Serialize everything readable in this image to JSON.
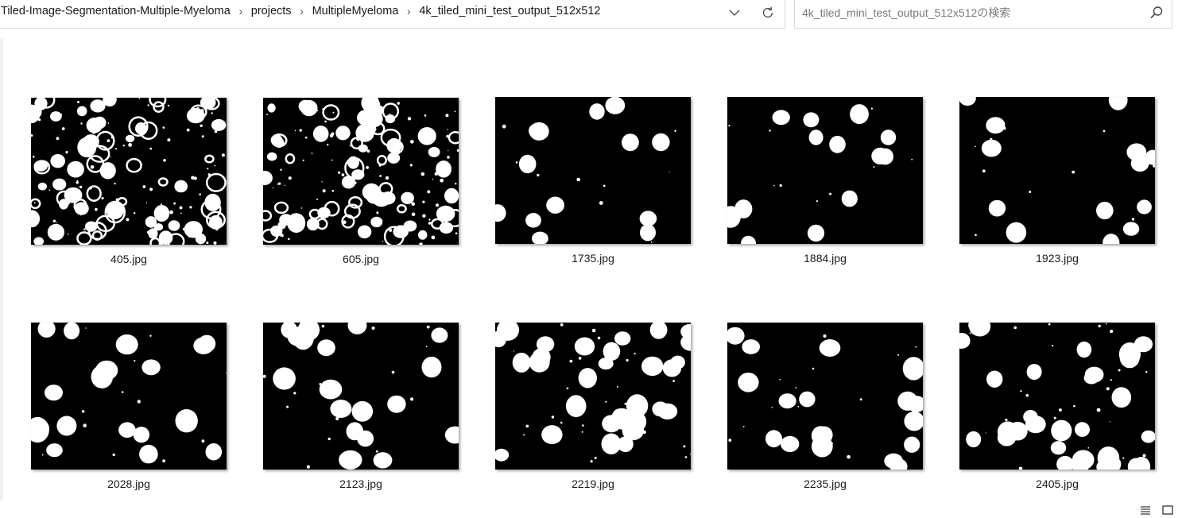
{
  "address_bar": {
    "breadcrumbs": [
      "Tiled-Image-Segmentation-Multiple-Myeloma",
      "projects",
      "MultipleMyeloma",
      "4k_tiled_mini_test_output_512x512"
    ]
  },
  "search": {
    "placeholder": "4k_tiled_mini_test_output_512x512の検索"
  },
  "files": [
    {
      "name": "405.jpg"
    },
    {
      "name": "605.jpg"
    },
    {
      "name": "1735.jpg"
    },
    {
      "name": "1884.jpg"
    },
    {
      "name": "1923.jpg"
    },
    {
      "name": "2028.jpg"
    },
    {
      "name": "2123.jpg"
    },
    {
      "name": "2219.jpg"
    },
    {
      "name": "2235.jpg"
    },
    {
      "name": "2405.jpg"
    }
  ],
  "icons": {
    "dropdown": "chevron-down-icon",
    "refresh": "refresh-icon",
    "search": "search-icon",
    "details_view": "details-view-icon",
    "large_icons_view": "large-icons-view-icon"
  },
  "colors": {
    "thumbnail_background": "#000000",
    "thumbnail_foreground": "#ffffff"
  }
}
